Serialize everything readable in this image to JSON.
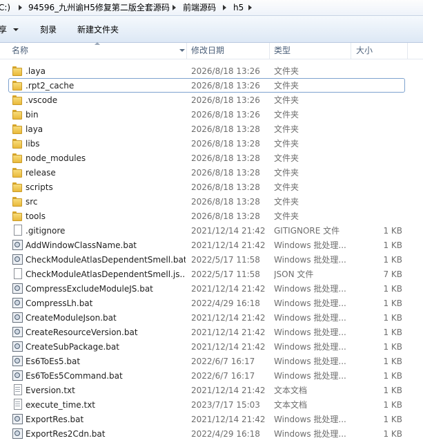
{
  "breadcrumb": {
    "root": "C:)",
    "items": [
      "94596_九州谕H5修复第二版全套源码",
      "前端源码",
      "h5"
    ]
  },
  "toolbar": {
    "share_label": "享",
    "burn_label": "刻录",
    "new_folder_label": "新建文件夹"
  },
  "columns": {
    "name": "名称",
    "date": "修改日期",
    "type": "类型",
    "size": "大小"
  },
  "files": [
    {
      "name": ".laya",
      "date": "2026/8/18 13:26",
      "type": "文件夹",
      "size": "",
      "icon": "folder-icon"
    },
    {
      "name": ".rpt2_cache",
      "date": "2026/8/18 13:26",
      "type": "文件夹",
      "size": "",
      "icon": "folder-icon"
    },
    {
      "name": ".vscode",
      "date": "2026/8/18 13:26",
      "type": "文件夹",
      "size": "",
      "icon": "folder-icon"
    },
    {
      "name": "bin",
      "date": "2026/8/18 13:26",
      "type": "文件夹",
      "size": "",
      "icon": "folder-icon"
    },
    {
      "name": "laya",
      "date": "2026/8/18 13:28",
      "type": "文件夹",
      "size": "",
      "icon": "folder-icon"
    },
    {
      "name": "libs",
      "date": "2026/8/18 13:28",
      "type": "文件夹",
      "size": "",
      "icon": "folder-icon"
    },
    {
      "name": "node_modules",
      "date": "2026/8/18 13:28",
      "type": "文件夹",
      "size": "",
      "icon": "folder-icon"
    },
    {
      "name": "release",
      "date": "2026/8/18 13:28",
      "type": "文件夹",
      "size": "",
      "icon": "folder-icon"
    },
    {
      "name": "scripts",
      "date": "2026/8/18 13:28",
      "type": "文件夹",
      "size": "",
      "icon": "folder-icon"
    },
    {
      "name": "src",
      "date": "2026/8/18 13:28",
      "type": "文件夹",
      "size": "",
      "icon": "folder-icon"
    },
    {
      "name": "tools",
      "date": "2026/8/18 13:28",
      "type": "文件夹",
      "size": "",
      "icon": "folder-icon"
    },
    {
      "name": ".gitignore",
      "date": "2021/12/14 21:42",
      "type": "GITIGNORE 文件",
      "size": "1 KB",
      "icon": "file-icon"
    },
    {
      "name": "AddWindowClassName.bat",
      "date": "2021/12/14 21:42",
      "type": "Windows 批处理...",
      "size": "1 KB",
      "icon": "batch-file-icon"
    },
    {
      "name": "CheckModuleAtlasDependentSmell.bat",
      "date": "2022/5/17 11:58",
      "type": "Windows 批处理...",
      "size": "1 KB",
      "icon": "batch-file-icon"
    },
    {
      "name": "CheckModuleAtlasDependentSmell.js...",
      "date": "2022/5/17 11:58",
      "type": "JSON 文件",
      "size": "7 KB",
      "icon": "file-icon"
    },
    {
      "name": "CompressExcludeModuleJS.bat",
      "date": "2021/12/14 21:42",
      "type": "Windows 批处理...",
      "size": "1 KB",
      "icon": "batch-file-icon"
    },
    {
      "name": "CompressLh.bat",
      "date": "2022/4/29 16:18",
      "type": "Windows 批处理...",
      "size": "1 KB",
      "icon": "batch-file-icon"
    },
    {
      "name": "CreateModuleJson.bat",
      "date": "2021/12/14 21:42",
      "type": "Windows 批处理...",
      "size": "1 KB",
      "icon": "batch-file-icon"
    },
    {
      "name": "CreateResourceVersion.bat",
      "date": "2021/12/14 21:42",
      "type": "Windows 批处理...",
      "size": "1 KB",
      "icon": "batch-file-icon"
    },
    {
      "name": "CreateSubPackage.bat",
      "date": "2021/12/14 21:42",
      "type": "Windows 批处理...",
      "size": "1 KB",
      "icon": "batch-file-icon"
    },
    {
      "name": "Es6ToEs5.bat",
      "date": "2022/6/7 16:17",
      "type": "Windows 批处理...",
      "size": "1 KB",
      "icon": "batch-file-icon"
    },
    {
      "name": "Es6ToEs5Command.bat",
      "date": "2022/6/7 16:17",
      "type": "Windows 批处理...",
      "size": "1 KB",
      "icon": "batch-file-icon"
    },
    {
      "name": "Eversion.txt",
      "date": "2021/12/14 21:42",
      "type": "文本文档",
      "size": "1 KB",
      "icon": "text-file-icon"
    },
    {
      "name": "execute_time.txt",
      "date": "2023/7/17 15:03",
      "type": "文本文档",
      "size": "1 KB",
      "icon": "text-file-icon"
    },
    {
      "name": "ExportRes.bat",
      "date": "2021/12/14 21:42",
      "type": "Windows 批处理...",
      "size": "1 KB",
      "icon": "batch-file-icon"
    },
    {
      "name": "ExportRes2Cdn.bat",
      "date": "2022/4/29 16:18",
      "type": "Windows 批处理...",
      "size": "1 KB",
      "icon": "batch-file-icon"
    }
  ],
  "focused_index": 1
}
